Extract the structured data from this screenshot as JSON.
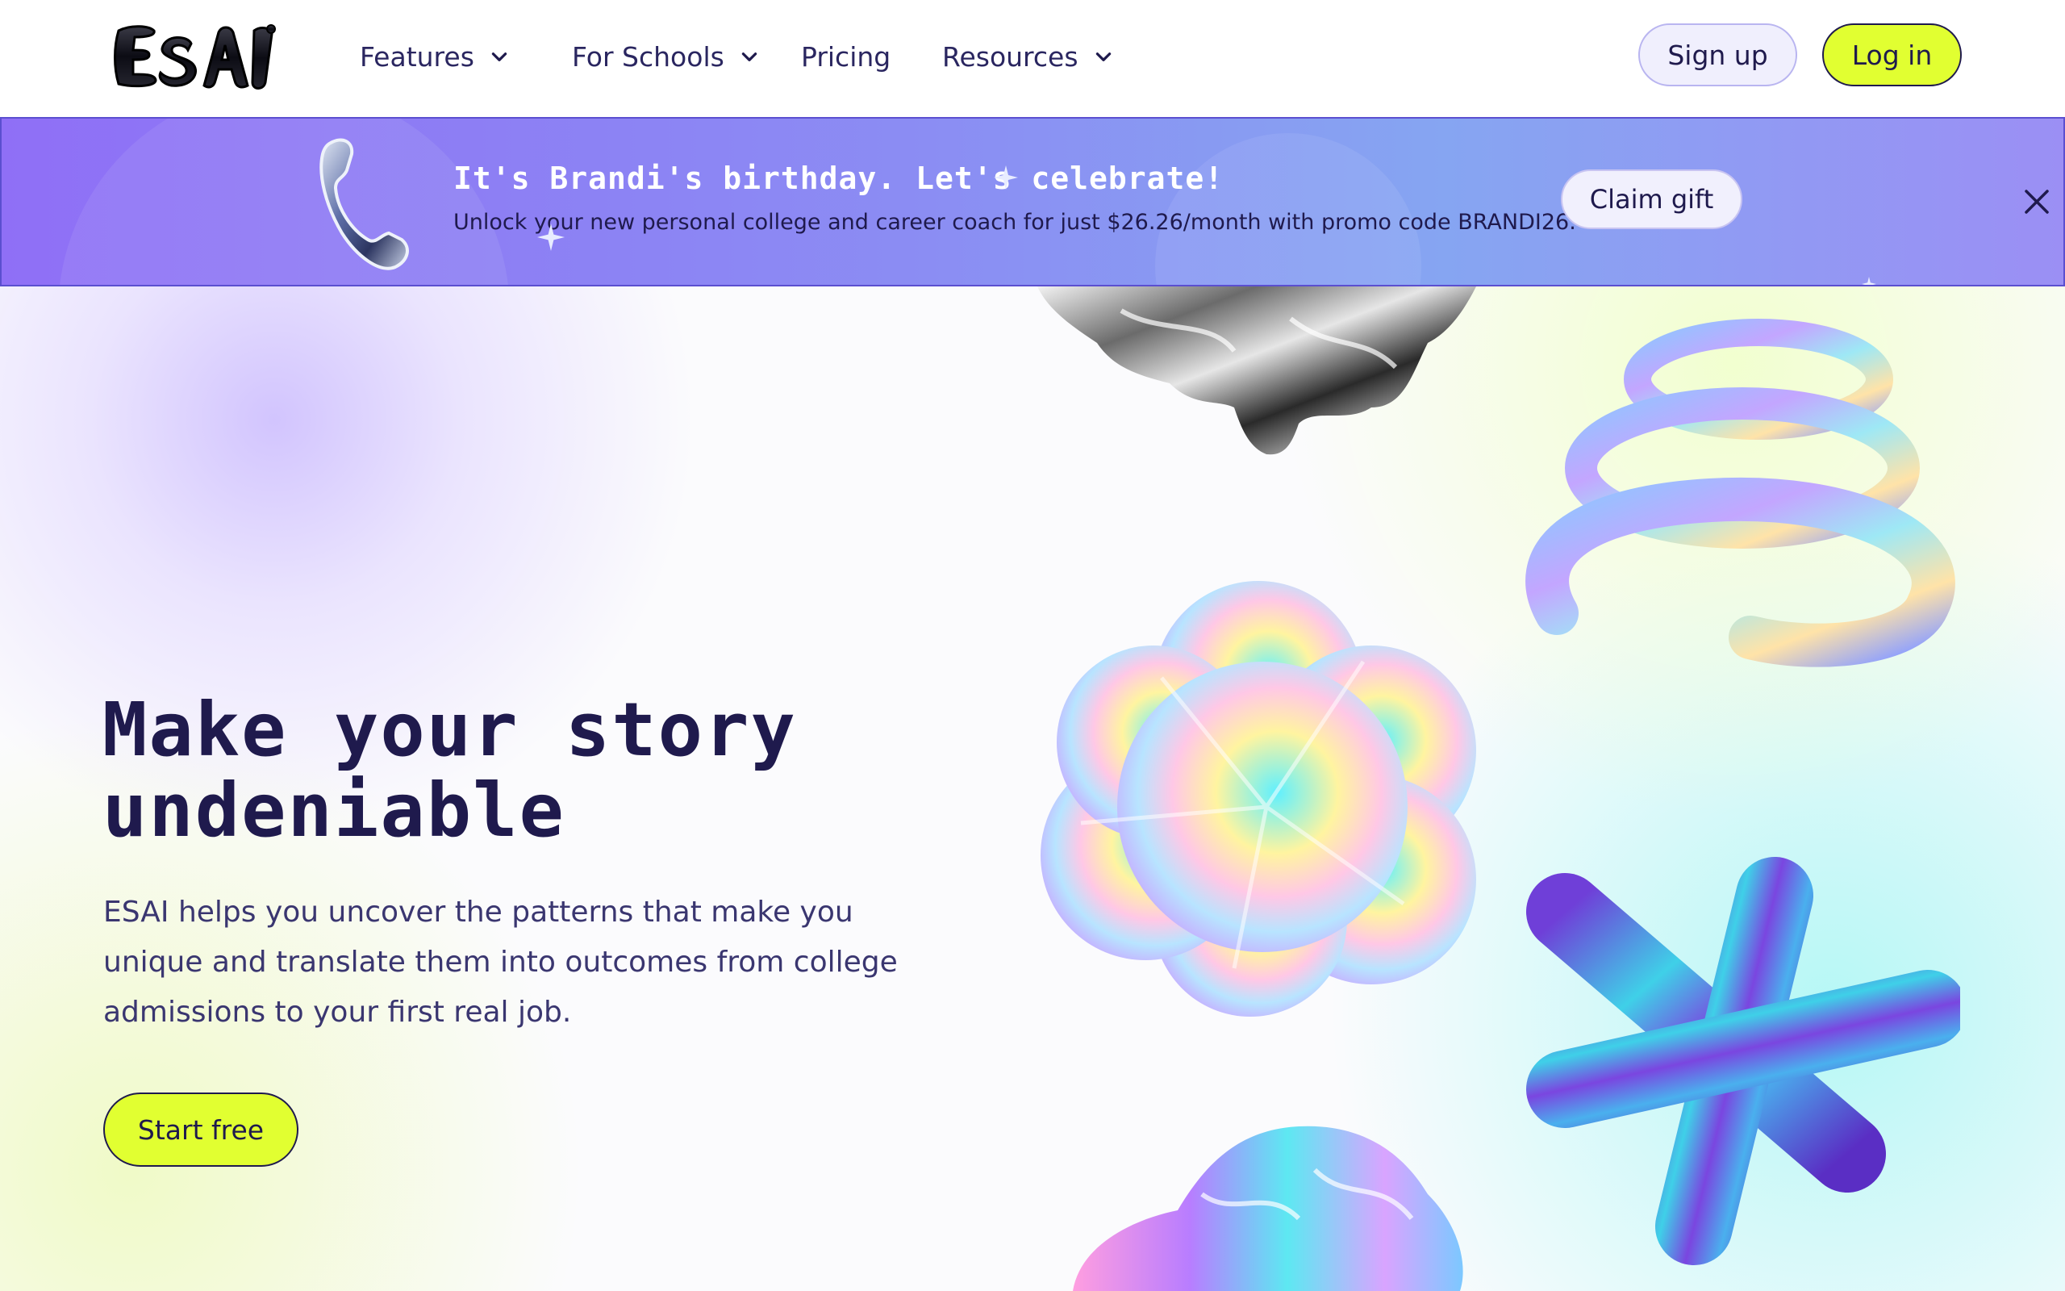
{
  "nav": {
    "logo_text": "ESAI",
    "items": [
      {
        "label": "Features",
        "has_dropdown": true
      },
      {
        "label": "For Schools",
        "has_dropdown": true
      },
      {
        "label": "Pricing",
        "has_dropdown": false
      },
      {
        "label": "Resources",
        "has_dropdown": true
      }
    ],
    "signup_label": "Sign up",
    "login_label": "Log in"
  },
  "banner": {
    "title": "It's Brandi's birthday. Let's celebrate!",
    "subtitle": "Unlock your new personal college and career coach for just $26.26/month with promo code BRANDI26.",
    "claim_label": "Claim gift",
    "icon": "telephone-handset-icon",
    "close_icon": "close-icon"
  },
  "hero": {
    "title": "Make your story undeniable",
    "description": "ESAI helps you uncover the patterns that make you unique and translate them into outcomes from college admissions to your first real job.",
    "cta_label": "Start free"
  },
  "colors": {
    "accent_lime": "#e1ff31",
    "navy": "#1f1a4d",
    "banner_purple": "#8f6ff6",
    "banner_blue": "#86a5f2"
  }
}
